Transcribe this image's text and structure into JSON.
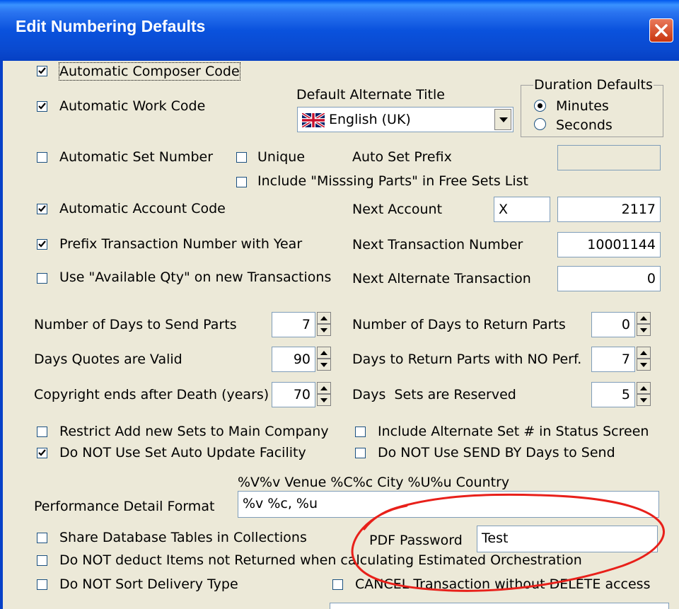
{
  "window": {
    "title": "Edit Numbering Defaults"
  },
  "checkboxes": {
    "auto_composer": {
      "label": "Automatic Composer Code",
      "checked": true
    },
    "auto_work": {
      "label": "Automatic Work Code",
      "checked": true
    },
    "auto_set": {
      "label": "Automatic Set Number",
      "checked": false
    },
    "unique": {
      "label": "Unique",
      "checked": false
    },
    "missing_parts": {
      "label": "Include \"Misssing Parts\" in Free Sets List",
      "checked": false
    },
    "auto_account": {
      "label": "Automatic Account Code",
      "checked": true
    },
    "prefix_txn": {
      "label": "Prefix Transaction Number with Year",
      "checked": true
    },
    "avail_qty": {
      "label": "Use \"Available Qty\" on new Transactions",
      "checked": false
    },
    "restrict_sets": {
      "label": "Restrict Add new Sets to Main Company",
      "checked": false
    },
    "no_auto_update": {
      "label": "Do NOT Use Set Auto Update Facility",
      "checked": true
    },
    "include_alt_set": {
      "label": "Include Alternate Set # in Status Screen",
      "checked": false
    },
    "no_send_by": {
      "label": "Do NOT Use SEND BY Days to Send",
      "checked": false
    },
    "share_db": {
      "label": "Share Database Tables in Collections",
      "checked": false
    },
    "no_deduct": {
      "label": "Do NOT deduct Items not Returned when calculating Estimated Orchestration",
      "checked": false
    },
    "no_sort": {
      "label": "Do NOT Sort Delivery Type",
      "checked": false
    },
    "cancel_txn": {
      "label": "CANCEL Transaction without DELETE access",
      "checked": false
    }
  },
  "alt_title": {
    "label": "Default Alternate Title",
    "value": "English (UK)",
    "flag_icon": "uk-flag-icon"
  },
  "duration": {
    "legend": "Duration Defaults",
    "minutes": "Minutes",
    "seconds": "Seconds",
    "selected": "Minutes"
  },
  "auto_set_prefix": {
    "label": "Auto Set Prefix",
    "value": ""
  },
  "next_account": {
    "label": "Next Account",
    "prefix": "X",
    "value": "2117"
  },
  "next_txn": {
    "label": "Next Transaction Number",
    "value": "10001144"
  },
  "next_alt_txn": {
    "label": "Next Alternate Transaction",
    "value": "0"
  },
  "days_send": {
    "label": "Number of Days to Send Parts",
    "value": "7"
  },
  "days_return": {
    "label": "Number of Days to Return Parts",
    "value": "0"
  },
  "quotes_valid": {
    "label": "Days Quotes are Valid",
    "value": "90"
  },
  "return_no_perf": {
    "label": "Days to Return Parts with NO Perf.",
    "value": "7"
  },
  "copyright": {
    "label": "Copyright ends after Death (years)",
    "value": "70"
  },
  "sets_reserved": {
    "label": "Days  Sets are Reserved",
    "value": "5"
  },
  "perf_format": {
    "hint": "%V%v Venue %C%c City %U%u Country",
    "label": "Performance Detail Format",
    "value": "%v %c, %u"
  },
  "pdf_password": {
    "label": "PDF Password",
    "value": "Test"
  },
  "colors": {
    "titlebar": "#0a52dd",
    "face": "#ece9d8",
    "annotation": "#e8201a"
  }
}
